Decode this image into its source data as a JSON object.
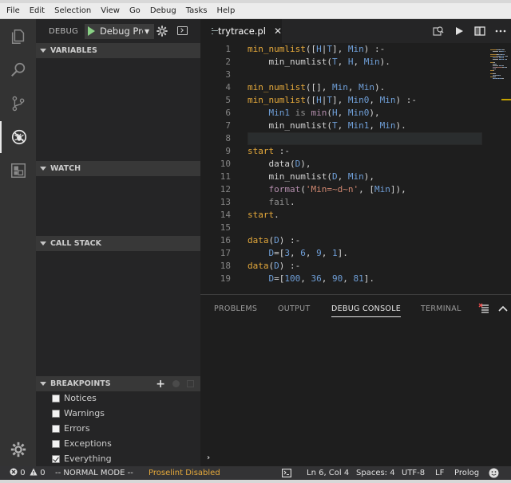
{
  "menu": [
    "File",
    "Edit",
    "Selection",
    "View",
    "Go",
    "Debug",
    "Tasks",
    "Help"
  ],
  "activity_icons": [
    "files-icon",
    "search-icon",
    "source-control-icon",
    "debug-icon",
    "extensions-icon",
    "settings-gear-icon"
  ],
  "debug": {
    "title": "DEBUG",
    "config": "Debug Pro"
  },
  "sections": {
    "variables": "VARIABLES",
    "watch": "WATCH",
    "call_stack": "CALL STACK",
    "breakpoints": "BREAKPOINTS"
  },
  "breakpoints": [
    {
      "label": "Notices",
      "checked": false
    },
    {
      "label": "Warnings",
      "checked": false
    },
    {
      "label": "Errors",
      "checked": false
    },
    {
      "label": "Exceptions",
      "checked": false
    },
    {
      "label": "Everything",
      "checked": true
    }
  ],
  "editor": {
    "tab": "trytrace.pl",
    "line_numbers": [
      "1",
      "2",
      "3",
      "4",
      "5",
      "6",
      "7",
      "8",
      "9",
      "10",
      "11",
      "12",
      "13",
      "14",
      "15",
      "16",
      "17",
      "18",
      "19"
    ],
    "current_line": 6
  },
  "code": [
    [
      [
        "min_numlist",
        "fn"
      ],
      [
        "(",
        "p"
      ],
      [
        "[",
        "p"
      ],
      [
        "H",
        "v"
      ],
      [
        "|",
        "p"
      ],
      [
        "T",
        "v"
      ],
      [
        "]",
        "p"
      ],
      [
        ", ",
        "p"
      ],
      [
        "Min",
        "v"
      ],
      [
        ") :-",
        "p"
      ]
    ],
    [
      [
        "    ",
        "p"
      ],
      [
        "min_numlist",
        "fn2"
      ],
      [
        "(",
        "p"
      ],
      [
        "T",
        "v"
      ],
      [
        ", ",
        "p"
      ],
      [
        "H",
        "v"
      ],
      [
        ", ",
        "p"
      ],
      [
        "Min",
        "v"
      ],
      [
        ").",
        "p"
      ]
    ],
    [],
    [
      [
        "min_numlist",
        "fn"
      ],
      [
        "(",
        "p"
      ],
      [
        "[]",
        "p"
      ],
      [
        ", ",
        "p"
      ],
      [
        "Min",
        "v"
      ],
      [
        ", ",
        "p"
      ],
      [
        "Min",
        "v"
      ],
      [
        ").",
        "p"
      ]
    ],
    [
      [
        "min_numlist",
        "fn"
      ],
      [
        "(",
        "p"
      ],
      [
        "[",
        "p"
      ],
      [
        "H",
        "v"
      ],
      [
        "|",
        "p"
      ],
      [
        "T",
        "v"
      ],
      [
        "]",
        "p"
      ],
      [
        ", ",
        "p"
      ],
      [
        "Min0",
        "v"
      ],
      [
        ", ",
        "p"
      ],
      [
        "Min",
        "v"
      ],
      [
        ") :-",
        "p"
      ]
    ],
    [
      [
        "    ",
        "p"
      ],
      [
        "Min1",
        "v"
      ],
      [
        " is ",
        "kw"
      ],
      [
        "min",
        "bi"
      ],
      [
        "(",
        "p"
      ],
      [
        "H",
        "v"
      ],
      [
        ", ",
        "p"
      ],
      [
        "Min0",
        "v"
      ],
      [
        "),",
        "p"
      ]
    ],
    [
      [
        "    ",
        "p"
      ],
      [
        "min_numlist",
        "fn2"
      ],
      [
        "(",
        "p"
      ],
      [
        "T",
        "v"
      ],
      [
        ", ",
        "p"
      ],
      [
        "Min1",
        "v"
      ],
      [
        ", ",
        "p"
      ],
      [
        "Min",
        "v"
      ],
      [
        ").",
        "p"
      ]
    ],
    [],
    [
      [
        "start",
        "fn"
      ],
      [
        " :-",
        "p"
      ]
    ],
    [
      [
        "    ",
        "p"
      ],
      [
        "data",
        "fn2"
      ],
      [
        "(",
        "p"
      ],
      [
        "D",
        "v"
      ],
      [
        "),",
        "p"
      ]
    ],
    [
      [
        "    ",
        "p"
      ],
      [
        "min_numlist",
        "fn2"
      ],
      [
        "(",
        "p"
      ],
      [
        "D",
        "v"
      ],
      [
        ", ",
        "p"
      ],
      [
        "Min",
        "v"
      ],
      [
        "),",
        "p"
      ]
    ],
    [
      [
        "    ",
        "p"
      ],
      [
        "format",
        "bi"
      ],
      [
        "(",
        "p"
      ],
      [
        "'Min=~d~n'",
        "str"
      ],
      [
        ", ",
        "p"
      ],
      [
        "[",
        "p"
      ],
      [
        "Min",
        "v"
      ],
      [
        "]",
        "p"
      ],
      [
        "),",
        "p"
      ]
    ],
    [
      [
        "    ",
        "p"
      ],
      [
        "fail",
        "kw"
      ],
      [
        ".",
        "p"
      ]
    ],
    [
      [
        "start",
        "fn"
      ],
      [
        ".",
        "p"
      ]
    ],
    [],
    [
      [
        "data",
        "fn"
      ],
      [
        "(",
        "p"
      ],
      [
        "D",
        "v"
      ],
      [
        ") :-",
        "p"
      ]
    ],
    [
      [
        "    ",
        "p"
      ],
      [
        "D",
        "v"
      ],
      [
        "=[",
        "p"
      ],
      [
        "3",
        "num"
      ],
      [
        ", ",
        "p"
      ],
      [
        "6",
        "num"
      ],
      [
        ", ",
        "p"
      ],
      [
        "9",
        "num"
      ],
      [
        ", ",
        "p"
      ],
      [
        "1",
        "num"
      ],
      [
        "].",
        "p"
      ]
    ],
    [
      [
        "data",
        "fn"
      ],
      [
        "(",
        "p"
      ],
      [
        "D",
        "v"
      ],
      [
        ") :-",
        "p"
      ]
    ],
    [
      [
        "    ",
        "p"
      ],
      [
        "D",
        "v"
      ],
      [
        "=[",
        "p"
      ],
      [
        "100",
        "num"
      ],
      [
        ", ",
        "p"
      ],
      [
        "36",
        "num"
      ],
      [
        ", ",
        "p"
      ],
      [
        "90",
        "num"
      ],
      [
        ", ",
        "p"
      ],
      [
        "81",
        "num"
      ],
      [
        "].",
        "p"
      ]
    ]
  ],
  "syntax_colors": {
    "fn": "#e5a93b",
    "fn2": "#d4d4d4",
    "v": "#6f9fd8",
    "p": "#d4d4d4",
    "kw": "#909090",
    "bi": "#b48ead",
    "str": "#d08770",
    "num": "#6f9fd8"
  },
  "panel": {
    "tabs": [
      "PROBLEMS",
      "OUTPUT",
      "DEBUG CONSOLE",
      "TERMINAL"
    ],
    "active_tab": "DEBUG CONSOLE",
    "prompt": "›"
  },
  "status": {
    "errors": "0",
    "warnings": "0",
    "mode": "-- NORMAL MODE --",
    "proselint": "Proselint Disabled",
    "position": "Ln 6, Col 4",
    "spaces": "Spaces: 4",
    "encoding": "UTF-8",
    "eol": "LF",
    "language": "Prolog"
  },
  "colors": {
    "proselint": "#e5a93b",
    "accent_green": "#89d185"
  }
}
